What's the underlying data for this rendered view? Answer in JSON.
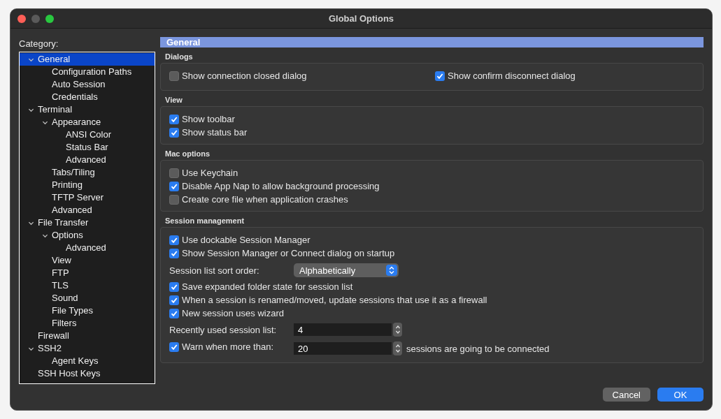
{
  "window": {
    "title": "Global Options"
  },
  "category": {
    "label": "Category:",
    "items": [
      {
        "label": "General",
        "selected": true,
        "expanded": true,
        "children": [
          {
            "label": "Configuration Paths",
            "selected": false
          },
          {
            "label": "Auto Session",
            "selected": false
          },
          {
            "label": "Credentials",
            "selected": false
          }
        ]
      },
      {
        "label": "Terminal",
        "selected": false,
        "expanded": true,
        "children": [
          {
            "label": "Appearance",
            "selected": false,
            "expanded": true,
            "children": [
              {
                "label": "ANSI Color",
                "selected": false
              },
              {
                "label": "Status Bar",
                "selected": false
              },
              {
                "label": "Advanced",
                "selected": false
              }
            ]
          },
          {
            "label": "Tabs/Tiling",
            "selected": false
          },
          {
            "label": "Printing",
            "selected": false
          },
          {
            "label": "TFTP Server",
            "selected": false
          },
          {
            "label": "Advanced",
            "selected": false
          }
        ]
      },
      {
        "label": "File Transfer",
        "selected": false,
        "expanded": true,
        "children": [
          {
            "label": "Options",
            "selected": false,
            "expanded": true,
            "children": [
              {
                "label": "Advanced",
                "selected": false
              }
            ]
          },
          {
            "label": "View",
            "selected": false
          },
          {
            "label": "FTP",
            "selected": false
          },
          {
            "label": "TLS",
            "selected": false
          },
          {
            "label": "Sound",
            "selected": false
          },
          {
            "label": "File Types",
            "selected": false
          },
          {
            "label": "Filters",
            "selected": false
          }
        ]
      },
      {
        "label": "Firewall",
        "selected": false
      },
      {
        "label": "SSH2",
        "selected": false,
        "expanded": true,
        "children": [
          {
            "label": "Agent Keys",
            "selected": false
          }
        ]
      },
      {
        "label": "SSH Host Keys",
        "selected": false
      }
    ]
  },
  "page": {
    "title": "General",
    "sections": [
      {
        "title": "Dialogs",
        "kind": "row",
        "items": [
          {
            "kind": "check",
            "label": "Show connection closed dialog",
            "checked": false
          },
          {
            "kind": "check",
            "label": "Show confirm disconnect dialog",
            "checked": true
          }
        ]
      },
      {
        "title": "View",
        "items": [
          {
            "kind": "check",
            "label": "Show toolbar",
            "checked": true
          },
          {
            "kind": "check",
            "label": "Show status bar",
            "checked": true
          }
        ]
      },
      {
        "title": "Mac options",
        "items": [
          {
            "kind": "check",
            "label": "Use Keychain",
            "checked": false
          },
          {
            "kind": "check",
            "label": "Disable App Nap to allow background processing",
            "checked": true
          },
          {
            "kind": "check",
            "label": "Create core file when application crashes",
            "checked": false
          }
        ]
      },
      {
        "title": "Session management",
        "items": [
          {
            "kind": "check",
            "label": "Use dockable Session Manager",
            "checked": true
          },
          {
            "kind": "check",
            "label": "Show Session Manager or Connect dialog on startup",
            "checked": true
          },
          {
            "kind": "select",
            "label": "Session list sort order:",
            "value": "Alphabetically"
          },
          {
            "kind": "check",
            "label": "Save expanded folder state for session list",
            "checked": true
          },
          {
            "kind": "check",
            "label": "When a session is renamed/moved, update sessions that use it as a firewall",
            "checked": true
          },
          {
            "kind": "check",
            "label": "New session uses wizard",
            "checked": true
          },
          {
            "kind": "spin",
            "label": "Recently used session list:",
            "value": "4"
          },
          {
            "kind": "spin",
            "label": "Warn when more than:",
            "checked": true,
            "value": "20",
            "suffix": "sessions are going to be connected"
          }
        ]
      }
    ]
  },
  "buttons": [
    {
      "label": "Cancel",
      "kind": "secondary"
    },
    {
      "label": "OK",
      "kind": "primary"
    }
  ]
}
